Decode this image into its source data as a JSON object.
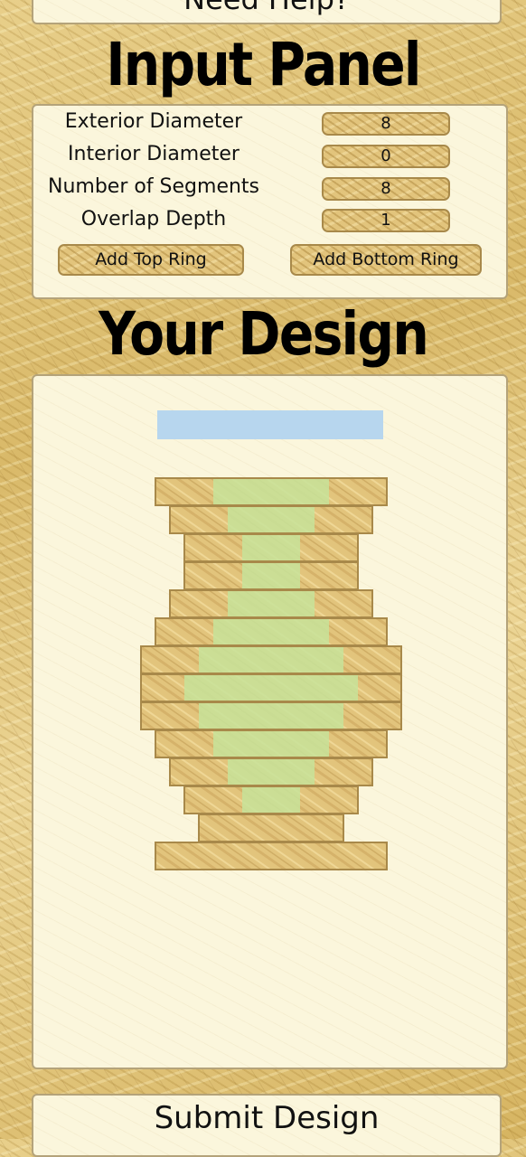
{
  "help_button": "Need Help?",
  "input_panel": {
    "title": "Input Panel",
    "fields": [
      {
        "label": "Exterior Diameter",
        "value": "8"
      },
      {
        "label": "Interior Diameter",
        "value": "0"
      },
      {
        "label": "Number of Segments",
        "value": "8"
      },
      {
        "label": "Overlap Depth",
        "value": "1"
      }
    ],
    "add_top_label": "Add Top Ring",
    "add_bottom_label": "Add Bottom Ring"
  },
  "design": {
    "title": "Your Design",
    "selection_color": "#b7d6ee",
    "wood_color": "#e2c47c",
    "wood_border_color": "#a8894a",
    "overlap_color": "#c7e39a",
    "rings": [
      {
        "outer": 8,
        "inner": 4
      },
      {
        "outer": 7,
        "inner": 3
      },
      {
        "outer": 6,
        "inner": 2
      },
      {
        "outer": 6,
        "inner": 2
      },
      {
        "outer": 7,
        "inner": 3
      },
      {
        "outer": 8,
        "inner": 4
      },
      {
        "outer": 9,
        "inner": 5
      },
      {
        "outer": 9,
        "inner": 6
      },
      {
        "outer": 9,
        "inner": 5
      },
      {
        "outer": 8,
        "inner": 4
      },
      {
        "outer": 7,
        "inner": 3
      },
      {
        "outer": 6,
        "inner": 2
      },
      {
        "outer": 5,
        "inner": 0
      },
      {
        "outer": 8,
        "inner": 0
      }
    ]
  },
  "submit_button": "Submit Design"
}
